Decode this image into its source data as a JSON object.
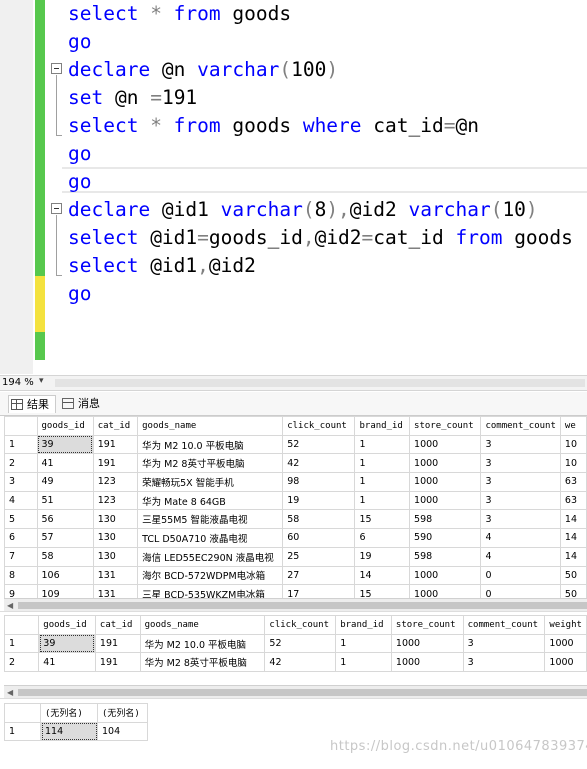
{
  "editor": {
    "lines": [
      {
        "id": "l1",
        "parts": [
          [
            "kw",
            "select "
          ],
          [
            "op",
            "* "
          ],
          [
            "kw",
            "from "
          ],
          [
            "",
            "goods"
          ]
        ]
      },
      {
        "id": "l2",
        "parts": [
          [
            "kw",
            "go"
          ]
        ]
      },
      {
        "id": "l3",
        "parts": [
          [
            "kw",
            "declare "
          ],
          [
            "",
            "@n "
          ],
          [
            "kw",
            "varchar"
          ],
          [
            "gy",
            "("
          ],
          [
            "",
            "100"
          ],
          [
            "gy",
            ")"
          ]
        ]
      },
      {
        "id": "l4",
        "parts": [
          [
            "kw",
            "set "
          ],
          [
            "",
            "@n "
          ],
          [
            "gy",
            "="
          ],
          [
            "",
            "191"
          ]
        ]
      },
      {
        "id": "l5",
        "parts": [
          [
            "kw",
            "select "
          ],
          [
            "op",
            "* "
          ],
          [
            "kw",
            "from "
          ],
          [
            "",
            "goods "
          ],
          [
            "kw",
            "where "
          ],
          [
            "",
            "cat_id"
          ],
          [
            "gy",
            "="
          ],
          [
            "",
            "@n"
          ]
        ]
      },
      {
        "id": "l6",
        "parts": [
          [
            "kw",
            "go"
          ]
        ]
      },
      {
        "id": "l7",
        "parts": [
          [
            "kw",
            "go"
          ]
        ]
      },
      {
        "id": "l8",
        "parts": [
          [
            "kw",
            "declare "
          ],
          [
            "",
            "@id1 "
          ],
          [
            "kw",
            "varchar"
          ],
          [
            "gy",
            "("
          ],
          [
            "",
            "8"
          ],
          [
            "gy",
            "),"
          ],
          [
            "",
            "@id2 "
          ],
          [
            "kw",
            "varchar"
          ],
          [
            "gy",
            "("
          ],
          [
            "",
            "10"
          ],
          [
            "gy",
            ")"
          ]
        ]
      },
      {
        "id": "l9",
        "parts": [
          [
            "kw",
            "select "
          ],
          [
            "",
            "@id1"
          ],
          [
            "gy",
            "="
          ],
          [
            "",
            "goods_id"
          ],
          [
            "gy",
            ","
          ],
          [
            "",
            "@id2"
          ],
          [
            "gy",
            "="
          ],
          [
            "",
            "cat_id "
          ],
          [
            "kw",
            "from "
          ],
          [
            "",
            "goods"
          ]
        ]
      },
      {
        "id": "l10",
        "parts": [
          [
            "kw",
            "select "
          ],
          [
            "",
            "@id1"
          ],
          [
            "gy",
            ","
          ],
          [
            "",
            "@id2"
          ]
        ]
      },
      {
        "id": "l11",
        "parts": [
          [
            "kw",
            "go"
          ]
        ]
      }
    ]
  },
  "zoom": {
    "value": "194 %"
  },
  "tabs": {
    "results": "结果",
    "messages": "消息"
  },
  "grid1": {
    "columns": [
      "goods_id",
      "cat_id",
      "goods_name",
      "click_count",
      "brand_id",
      "store_count",
      "comment_count",
      "we"
    ],
    "rows": [
      [
        "1",
        "39",
        "191",
        "华为 M2 10.0 平板电脑",
        "52",
        "1",
        "1000",
        "3",
        "10"
      ],
      [
        "2",
        "41",
        "191",
        "华为 M2 8英寸平板电脑",
        "42",
        "1",
        "1000",
        "3",
        "10"
      ],
      [
        "3",
        "49",
        "123",
        "荣耀畅玩5X 智能手机",
        "98",
        "1",
        "1000",
        "3",
        "63"
      ],
      [
        "4",
        "51",
        "123",
        "华为 Mate 8 64GB",
        "19",
        "1",
        "1000",
        "3",
        "63"
      ],
      [
        "5",
        "56",
        "130",
        "三星55M5 智能液晶电视",
        "58",
        "15",
        "598",
        "3",
        "14"
      ],
      [
        "6",
        "57",
        "130",
        "TCL D50A710 液晶电视",
        "60",
        "6",
        "590",
        "4",
        "14"
      ],
      [
        "7",
        "58",
        "130",
        "海信 LED55EC290N 液晶电视",
        "25",
        "19",
        "598",
        "4",
        "14"
      ],
      [
        "8",
        "106",
        "131",
        "海尔 BCD-572WDPM电冰箱",
        "27",
        "14",
        "1000",
        "0",
        "50"
      ],
      [
        "9",
        "109",
        "131",
        "三星 BCD-535WKZM电冰箱",
        "17",
        "15",
        "1000",
        "0",
        "50"
      ]
    ]
  },
  "grid2": {
    "columns": [
      "goods_id",
      "cat_id",
      "goods_name",
      "click_count",
      "brand_id",
      "store_count",
      "comment_count",
      "weight"
    ],
    "rows": [
      [
        "1",
        "39",
        "191",
        "华为 M2 10.0 平板电脑",
        "52",
        "1",
        "1000",
        "3",
        "1000"
      ],
      [
        "2",
        "41",
        "191",
        "华为 M2 8英寸平板电脑",
        "42",
        "1",
        "1000",
        "3",
        "1000"
      ]
    ]
  },
  "grid3": {
    "columns": [
      "(无列名)",
      "(无列名)"
    ],
    "rows": [
      [
        "1",
        "114",
        "104"
      ]
    ]
  },
  "watermark": "https://blog.csdn.net/u010647839374"
}
